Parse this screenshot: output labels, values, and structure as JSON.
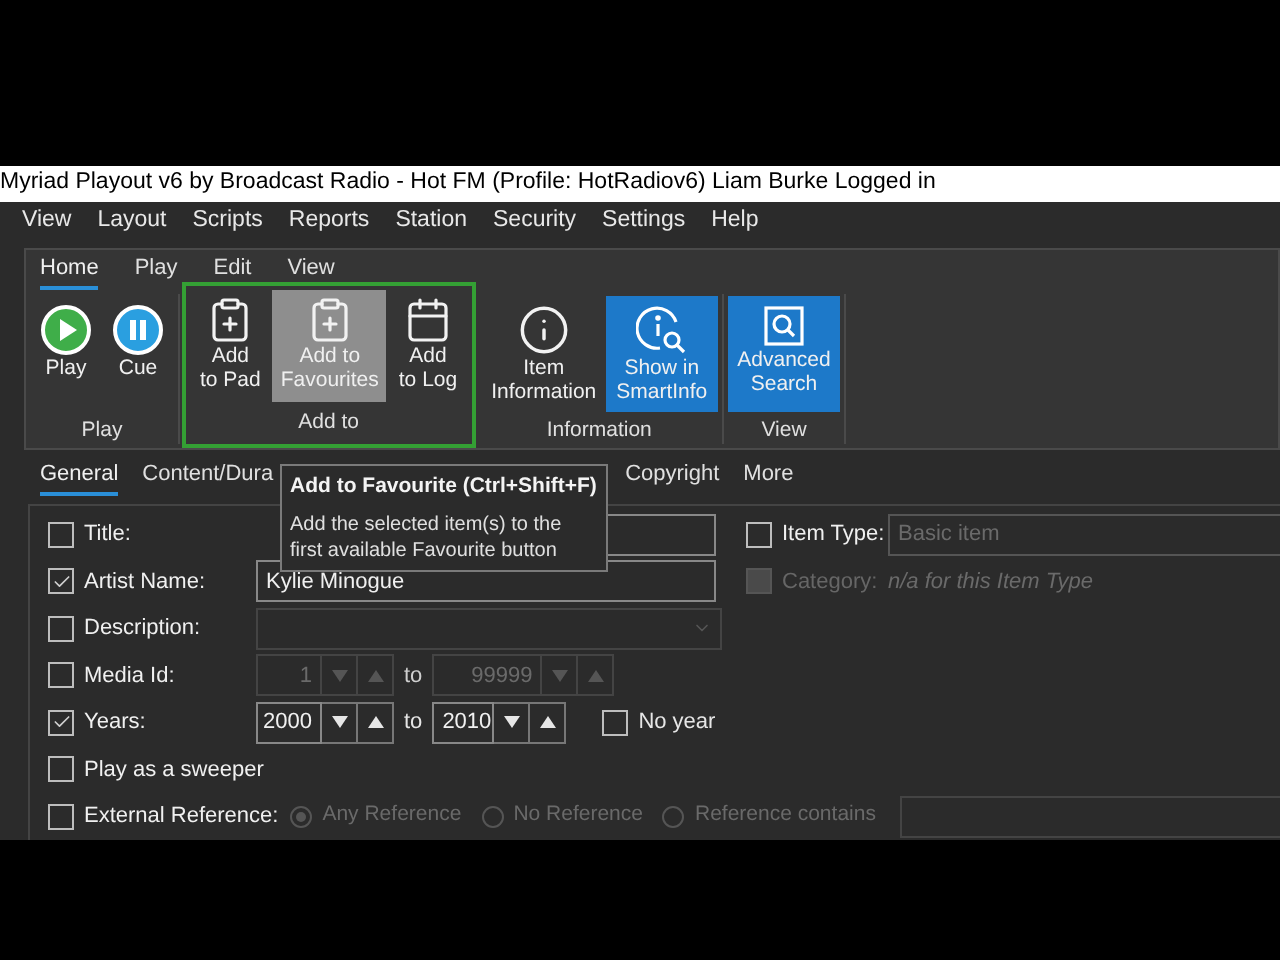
{
  "window": {
    "title": "Myriad Playout v6 by Broadcast Radio - Hot FM (Profile: HotRadiov6) Liam Burke Logged in"
  },
  "menu": [
    "View",
    "Layout",
    "Scripts",
    "Reports",
    "Station",
    "Security",
    "Settings",
    "Help"
  ],
  "ribbon": {
    "tabs": [
      {
        "label": "Home",
        "selected": true
      },
      {
        "label": "Play",
        "selected": false
      },
      {
        "label": "Edit",
        "selected": false
      },
      {
        "label": "View",
        "selected": false
      }
    ],
    "groups": [
      {
        "label": "Play",
        "outlined": false,
        "buttons": [
          {
            "lines": [
              "Play"
            ],
            "kind": "play",
            "hovered": false,
            "highlighted": false
          },
          {
            "lines": [
              "Cue"
            ],
            "kind": "pause",
            "hovered": false,
            "highlighted": false
          }
        ]
      },
      {
        "label": "Add to",
        "outlined": true,
        "buttons": [
          {
            "lines": [
              "Add",
              "to Pad"
            ],
            "kind": "clipboard",
            "hovered": false,
            "highlighted": false
          },
          {
            "lines": [
              "Add to",
              "Favourites"
            ],
            "kind": "clipboard",
            "hovered": true,
            "highlighted": false
          },
          {
            "lines": [
              "Add",
              "to Log"
            ],
            "kind": "calendar",
            "hovered": false,
            "highlighted": false
          }
        ]
      },
      {
        "label": "Information",
        "outlined": false,
        "buttons": [
          {
            "lines": [
              "Item",
              "Information"
            ],
            "kind": "info",
            "hovered": false,
            "highlighted": false
          },
          {
            "lines": [
              "Show in",
              "SmartInfo"
            ],
            "kind": "infosearch",
            "hovered": false,
            "highlighted": true
          }
        ]
      },
      {
        "label": "View",
        "outlined": false,
        "buttons": [
          {
            "lines": [
              "Advanced",
              "Search"
            ],
            "kind": "search",
            "hovered": false,
            "highlighted": true
          }
        ]
      }
    ]
  },
  "tooltip": {
    "title": "Add to Favourite (Ctrl+Shift+F)",
    "text": "Add the selected item(s) to the first available Favourite button"
  },
  "form": {
    "tabs": [
      {
        "label": "General",
        "selected": true
      },
      {
        "label": "Content/Dura",
        "selected": false
      },
      {
        "label": "Copyright",
        "selected": false
      },
      {
        "label": "More",
        "selected": false
      }
    ],
    "rows": [
      {
        "kind": "text",
        "label": "Title:",
        "checked": false,
        "side": {
          "kind": "select",
          "label": "Item Type:",
          "checked": false,
          "disabled": false,
          "placeholder": "Basic item"
        }
      },
      {
        "kind": "text",
        "label": "Artist Name:",
        "checked": true,
        "value": "Kylie Minogue",
        "side": {
          "kind": "note",
          "label": "Category:",
          "checked": false,
          "disabled": true,
          "note": "n/a for this Item Type"
        }
      },
      {
        "kind": "dropdown",
        "label": "Description:",
        "checked": false,
        "disabled": true
      },
      {
        "kind": "range",
        "label": "Media Id:",
        "checked": false,
        "disabled": true,
        "from": "1",
        "joiner": "to",
        "to": "99999"
      },
      {
        "kind": "range",
        "label": "Years:",
        "checked": true,
        "disabled": false,
        "from": "2000",
        "joiner": "to",
        "to": "2010",
        "extra": {
          "label": "No year",
          "checked": false
        }
      },
      {
        "kind": "plain",
        "label": "Play as a sweeper",
        "checked": false
      },
      {
        "kind": "radios",
        "label": "External Reference:",
        "checked": false,
        "disabled": true,
        "options": [
          {
            "label": "Any Reference",
            "selected": true
          },
          {
            "label": "No Reference",
            "selected": false
          },
          {
            "label": "Reference contains",
            "selected": false
          }
        ],
        "has_field": true
      }
    ]
  }
}
